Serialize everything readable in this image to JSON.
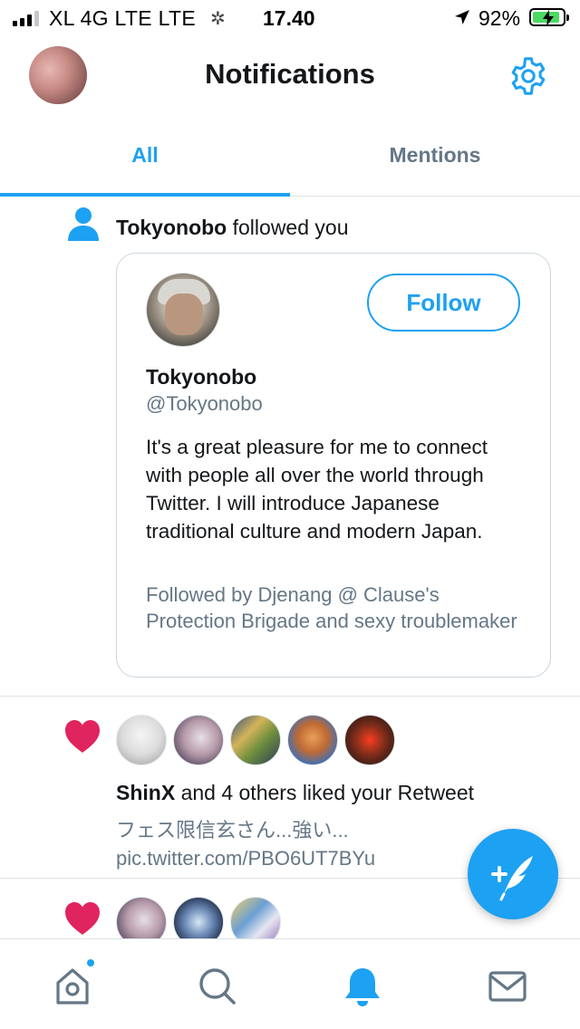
{
  "status_bar": {
    "carrier": "XL 4G LTE   LTE",
    "time": "17.40",
    "battery_percent": "92%",
    "battery_level": 0.92,
    "icons": [
      "signal-icon",
      "loading-spinner-icon",
      "location-arrow-icon",
      "battery-charging-icon"
    ]
  },
  "header": {
    "title": "Notifications",
    "icons": [
      "profile-avatar",
      "gear-icon"
    ]
  },
  "tabs": [
    {
      "label": "All",
      "active": true
    },
    {
      "label": "Mentions",
      "active": false
    }
  ],
  "notifications": [
    {
      "type": "follow",
      "icon": "person-icon",
      "user": "Tokyonobo",
      "action": "followed you",
      "card": {
        "name": "Tokyonobo",
        "handle": "@Tokyonobo",
        "follow_label": "Follow",
        "bio": "It's a great pleasure for me to connect with people all over the world through Twitter. I will introduce Japanese traditional culture and modern Japan.",
        "followed_by": "Followed by Djenang @ Clause's Protection Brigade and sexy troublemaker"
      }
    },
    {
      "type": "like",
      "icon": "heart-icon",
      "user": "ShinX",
      "action": "and 4 others liked your Retweet",
      "preview": "フェス限信玄さん...強い... pic.twitter.com/PBO6UT7BYu",
      "avatar_count": 5
    },
    {
      "type": "like",
      "icon": "heart-icon",
      "avatar_count": 3
    }
  ],
  "fab": {
    "icon": "compose-tweet-icon"
  },
  "bottom_nav": [
    {
      "name": "home",
      "icon": "home-icon",
      "has_badge": true
    },
    {
      "name": "search",
      "icon": "search-icon"
    },
    {
      "name": "notifications",
      "icon": "bell-icon",
      "active": true
    },
    {
      "name": "messages",
      "icon": "envelope-icon"
    }
  ],
  "colors": {
    "accent": "#1da1f2",
    "like": "#e0245e",
    "secondary_text": "#657786",
    "divider": "#dde2e6"
  }
}
